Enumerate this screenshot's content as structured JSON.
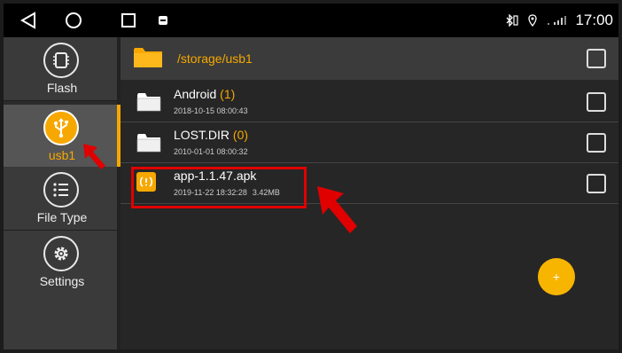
{
  "statusbar": {
    "time": "17:00",
    "icons": [
      "back-icon",
      "home-icon",
      "recent-apps-icon",
      "notification-icon",
      "bluetooth-icon",
      "location-icon",
      "signal-icon"
    ]
  },
  "sidebar": {
    "items": [
      {
        "label": "Flash",
        "icon": "chip-icon",
        "active": false
      },
      {
        "label": "usb1",
        "icon": "usb-icon",
        "active": true
      },
      {
        "label": "File Type",
        "icon": "list-icon",
        "active": false
      },
      {
        "label": "Settings",
        "icon": "gear-icon",
        "active": false
      }
    ]
  },
  "main": {
    "path": "/storage/usb1",
    "files": [
      {
        "name": "Android",
        "count": "(1)",
        "date": "2018-10-15 08:00:43",
        "size": "",
        "type": "folder"
      },
      {
        "name": "LOST.DIR",
        "count": "(0)",
        "date": "2010-01-01 08:00:32",
        "size": "",
        "type": "folder"
      },
      {
        "name": "app-1.1.47.apk",
        "count": "",
        "date": "2019-11-22 18:32:28",
        "size": "3.42MB",
        "type": "apk"
      }
    ],
    "fab_label": "+"
  },
  "colors": {
    "accent": "#f7a800",
    "annotation": "#e00000",
    "background": "#262626"
  }
}
